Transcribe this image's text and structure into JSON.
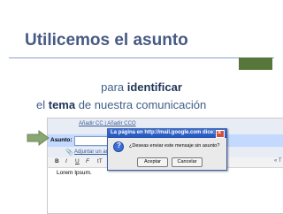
{
  "slide": {
    "title": "Utilicemos el asunto",
    "line1_pre": "para ",
    "line1_strong": "identificar",
    "line2_pre": "el ",
    "line2_strong": "tema",
    "line2_post": " de nuestra comunicación"
  },
  "compose": {
    "cc_links": "Añadir CC | Añadir CCO",
    "subject_label": "Asunto:",
    "attach_link": "Adjuntar un arch",
    "toolbar": {
      "bold": "B",
      "italic": "I",
      "underline": "U",
      "font": "F",
      "size": "tT",
      "color": "T"
    },
    "right_link": "« T",
    "body_text": "Lorem Ipsum."
  },
  "dialog": {
    "title": "La página en http://mail.google.com dice:",
    "message": "¿Deseas enviar este mensaje sin asunto?",
    "ok_label": "Aceptar",
    "cancel_label": "Cancelar"
  },
  "colors": {
    "title": "#475a85",
    "accent_green": "#57773a",
    "arrow_green": "#8aa672",
    "text": "#3f5f86"
  },
  "icons": [
    "arrow-icon",
    "question-icon",
    "paperclip-icon",
    "close-icon"
  ]
}
